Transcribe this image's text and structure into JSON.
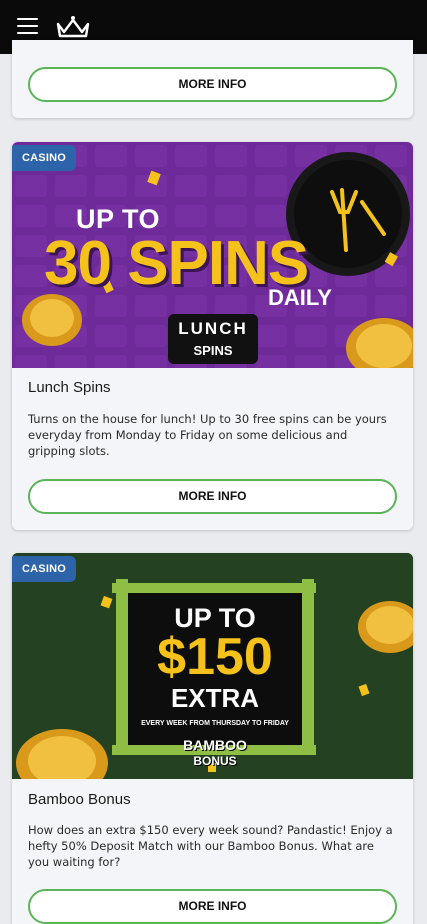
{
  "header": {
    "menu_icon": "hamburger-menu-icon",
    "logo_icon": "crown-logo-icon"
  },
  "cards": [
    {
      "button_label": "MORE INFO"
    },
    {
      "tag": "CASINO",
      "banner": {
        "line1": "UP TO",
        "line2": "30 SPINS",
        "line3": "DAILY",
        "badge_top": "LUNCH",
        "badge_bottom": "SPINS"
      },
      "title": "Lunch Spins",
      "description": "Turns on the house for lunch! Up to 30 free spins can be yours everyday from Monday to Friday on some delicious and gripping slots.",
      "button_label": "MORE INFO"
    },
    {
      "tag": "CASINO",
      "banner": {
        "line1": "UP TO",
        "line2": "$150",
        "line3": "EXTRA",
        "sub": "EVERY WEEK FROM THURSDAY TO FRIDAY",
        "badge_top": "BAMBOO",
        "badge_bottom": "BONUS"
      },
      "title": "Bamboo Bonus",
      "description": "How does an extra $150 every week sound? Pandastic! Enjoy a hefty 50% Deposit Match with our Bamboo Bonus. What are you waiting for?",
      "button_label": "MORE INFO"
    }
  ],
  "colors": {
    "accent_green": "#5bb557",
    "tag_blue": "#2d63a8",
    "banner_purple": "#6f2a99",
    "banner_green": "#1e3b1e",
    "gold": "#f4c21b"
  }
}
